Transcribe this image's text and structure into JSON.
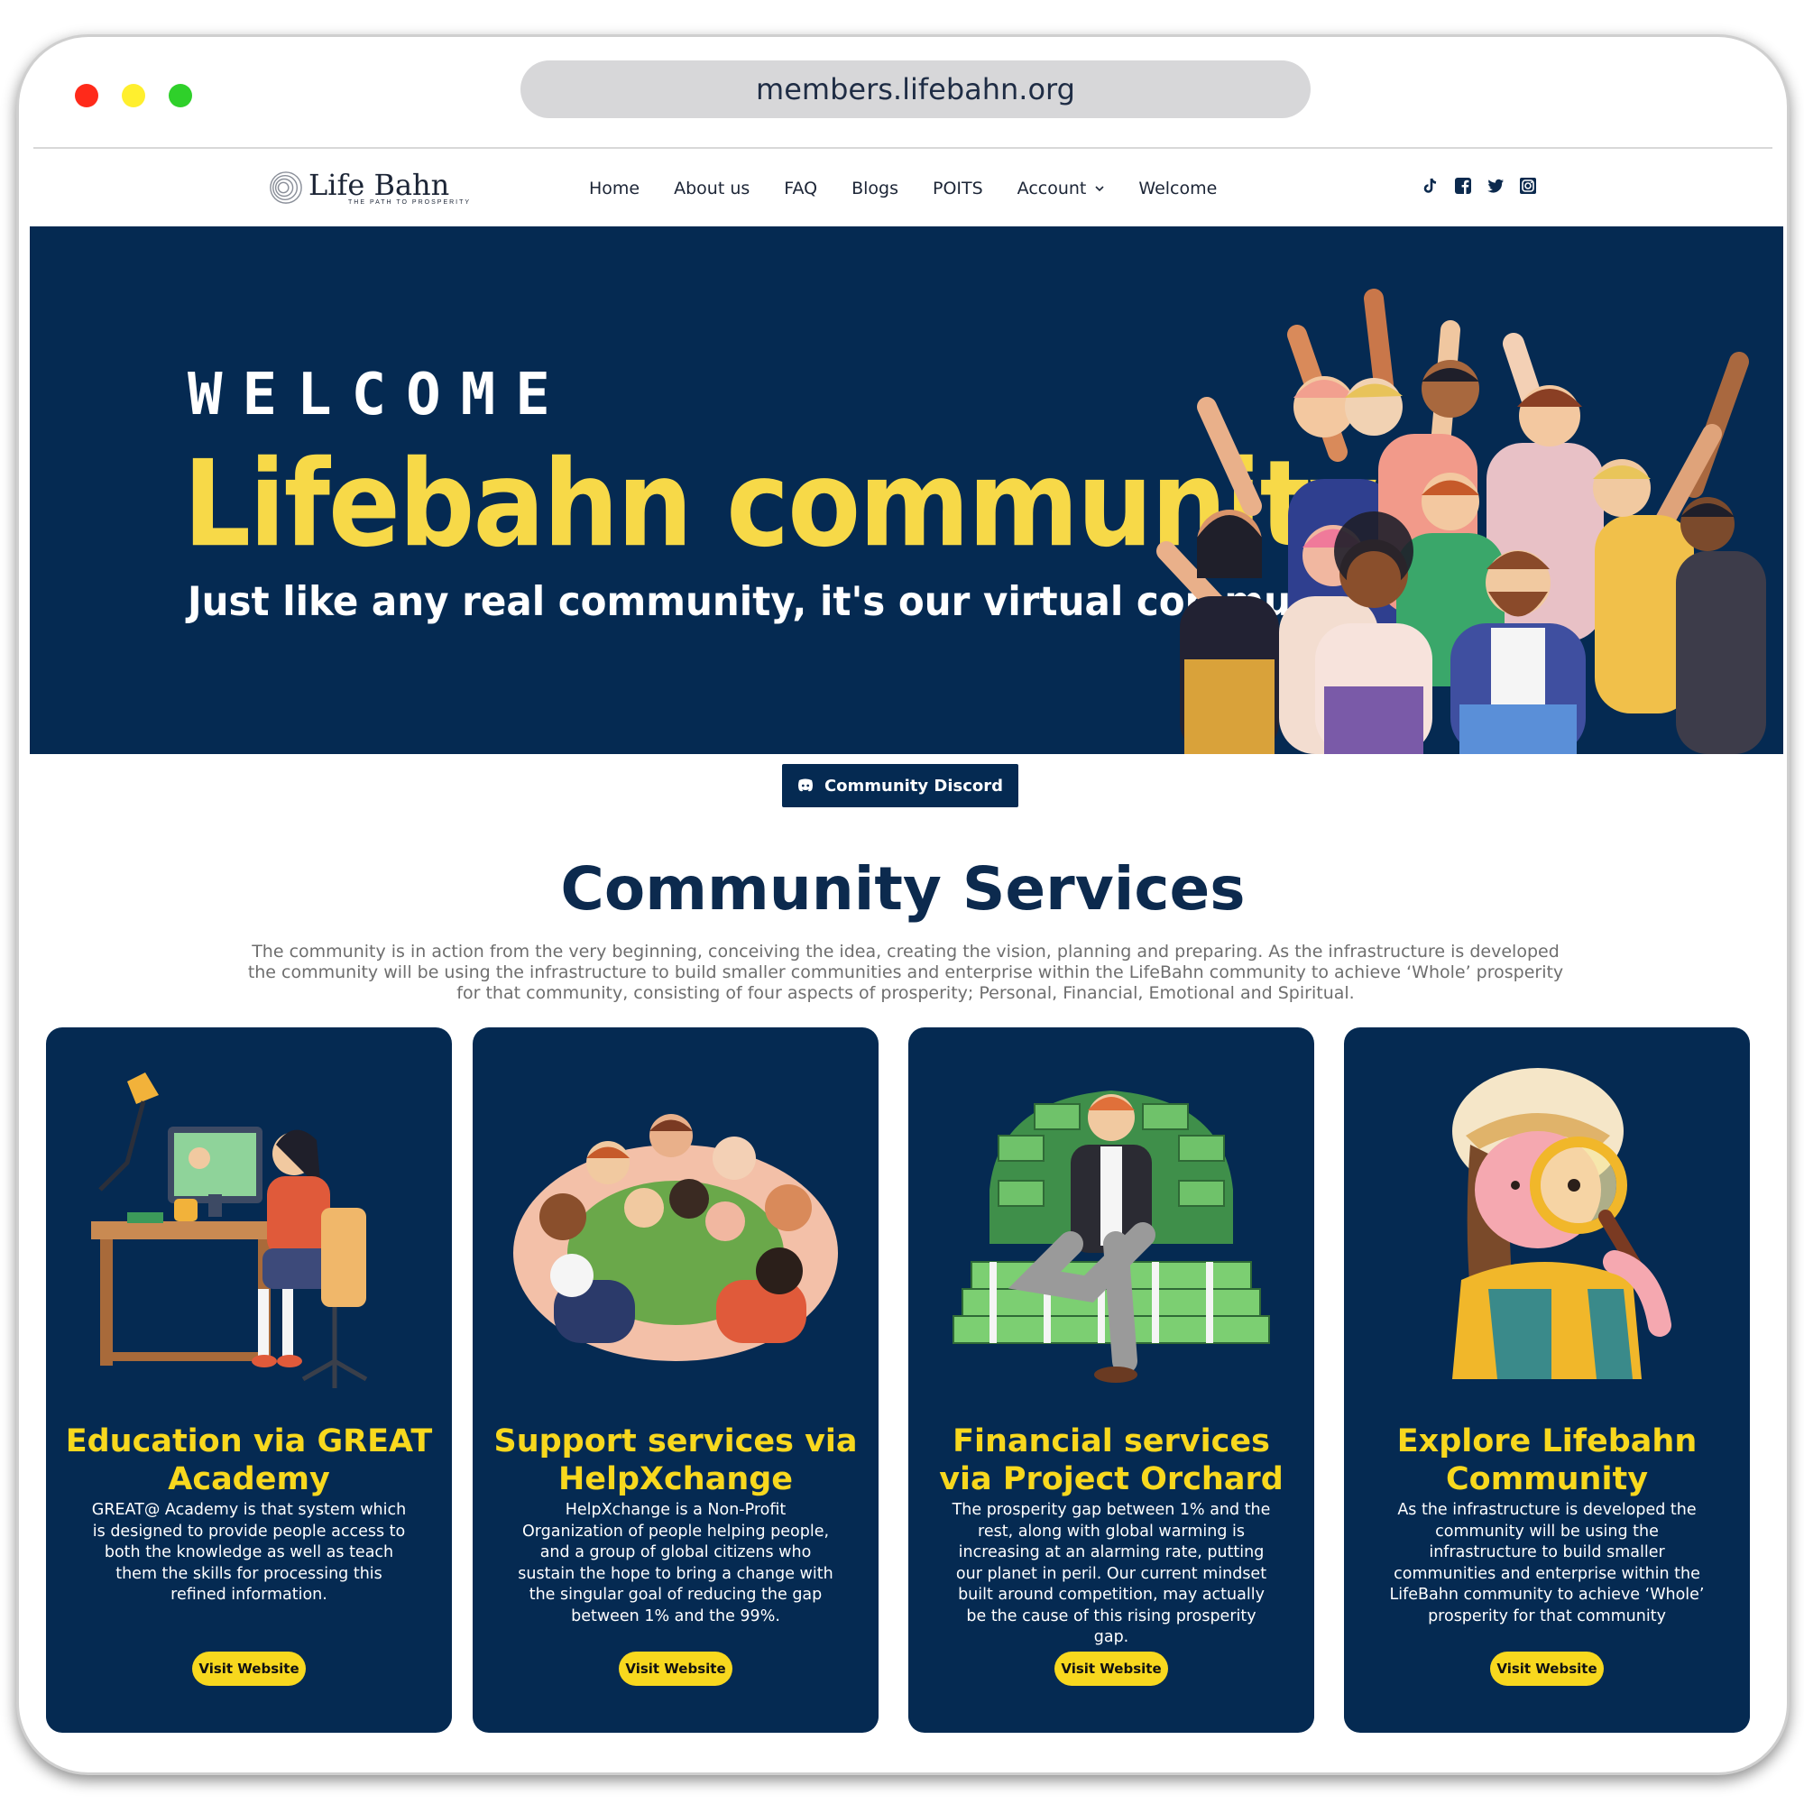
{
  "browser": {
    "url": "members.lifebahn.org"
  },
  "brand": {
    "name": "Life Bahn",
    "tagline": "THE PATH TO PROSPERITY"
  },
  "nav": {
    "items": [
      {
        "label": "Home"
      },
      {
        "label": "About us"
      },
      {
        "label": "FAQ"
      },
      {
        "label": "Blogs"
      },
      {
        "label": "POITS"
      },
      {
        "label": "Account"
      },
      {
        "label": "Welcome"
      }
    ],
    "socials": [
      "tiktok-icon",
      "facebook-icon",
      "twitter-icon",
      "instagram-icon"
    ]
  },
  "hero": {
    "kicker": "WELCOME",
    "title": "Lifebahn community",
    "subtitle": "Just like any real community, it's our virtual community"
  },
  "discord": {
    "label": "Community Discord"
  },
  "services": {
    "title": "Community Services",
    "intro": "The community is in action from the very beginning, conceiving the idea, creating the vision, planning and preparing. As the infrastructure is developed the community will be using the infrastructure to build smaller communities and enterprise within the LifeBahn community to achieve ‘Whole’ prosperity for that community, consisting of four aspects of prosperity; Personal, Financial, Emotional and Spiritual.",
    "cards": [
      {
        "title": "Education via GREAT Academy",
        "desc": "GREAT@ Academy is that system which is designed to provide people access to both the knowledge as well as teach them the skills for processing this refined information.",
        "button": "Visit  Website"
      },
      {
        "title": "Support services via HelpXchange",
        "desc": "HelpXchange is a Non-Profit Organization of people helping people, and a group of global citizens who sustain the hope to bring a change with the singular goal of reducing the gap between 1% and the 99%.",
        "button": "Visit  Website"
      },
      {
        "title": "Financial services via Project Orchard",
        "desc": "The prosperity gap between 1% and the rest, along with global warming is increasing at an alarming rate, putting our planet in peril. Our current mindset built around competition, may actually be the cause of this rising prosperity gap.",
        "button": "Visit  Website"
      },
      {
        "title": "Explore Lifebahn Community",
        "desc": "As the infrastructure is developed the community will be using the infrastructure to build smaller communities and enterprise within the LifeBahn community to achieve ‘Whole’ prosperity for that community",
        "button": "Visit  Website"
      }
    ]
  },
  "colors": {
    "navy": "#052a52",
    "yellow": "#f8d81e",
    "hero_title": "#f7d948"
  }
}
